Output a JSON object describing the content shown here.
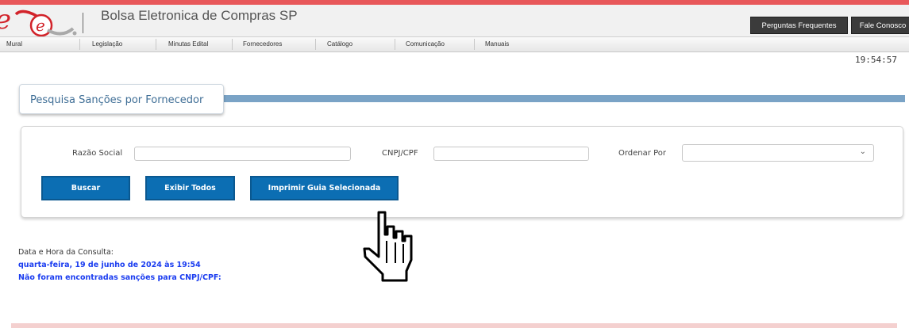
{
  "header": {
    "site_title": "Bolsa Eletronica de Compras SP",
    "faq_button": "Perguntas Frequentes",
    "contact_button": "Fale Conosco",
    "logo_colors": {
      "primary": "#d2232a",
      "secondary": "#a9a9a9"
    }
  },
  "nav": {
    "items": [
      "Mural",
      "Legislação",
      "Minutas Edital",
      "Fornecedores",
      "Catálogo",
      "Comunicação",
      "Manuais"
    ]
  },
  "clock": "19:54:57",
  "panel": {
    "title": "Pesquisa Sanções por Fornecedor"
  },
  "form": {
    "razao_label": "Razão Social",
    "razao_value": "",
    "cnpj_label": "CNPJ/CPF",
    "cnpj_value": "",
    "ordenar_label": "Ordenar Por",
    "ordenar_value": "",
    "buttons": {
      "buscar": "Buscar",
      "exibir": "Exibir Todos",
      "imprimir": "Imprimir Guia Selecionada"
    }
  },
  "result": {
    "label": "Data e Hora da Consulta:",
    "datetime": "quarta-feira, 19 de junho de 2024 às 19:54",
    "message": "Não foram encontradas sanções para CNPJ/CPF:"
  },
  "colors": {
    "button_blue": "#0c6eb3",
    "link_blue": "#1a3cf0",
    "tab_bar": "#7aa3c6",
    "header_dark": "#3b3b3b"
  }
}
